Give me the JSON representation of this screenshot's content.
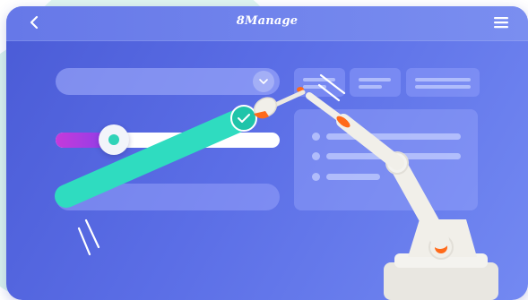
{
  "header": {
    "logo_text": "8Manage",
    "back_icon": "chevron-left-icon",
    "menu_icon": "hamburger-menu-icon"
  },
  "form": {
    "select_icon": "chevron-down-icon",
    "slider_value": 0.26,
    "toggle_icon": "checkmark-icon"
  },
  "colors": {
    "panel_start": "#4a5bd6",
    "panel_end": "#7389f2",
    "accent_teal": "#2fd3b8",
    "slider_gradient_start": "#c53adb",
    "slider_gradient_end": "#8a3ee8",
    "robot_body": "#f1efe9",
    "robot_joint": "#ff6a1a"
  }
}
